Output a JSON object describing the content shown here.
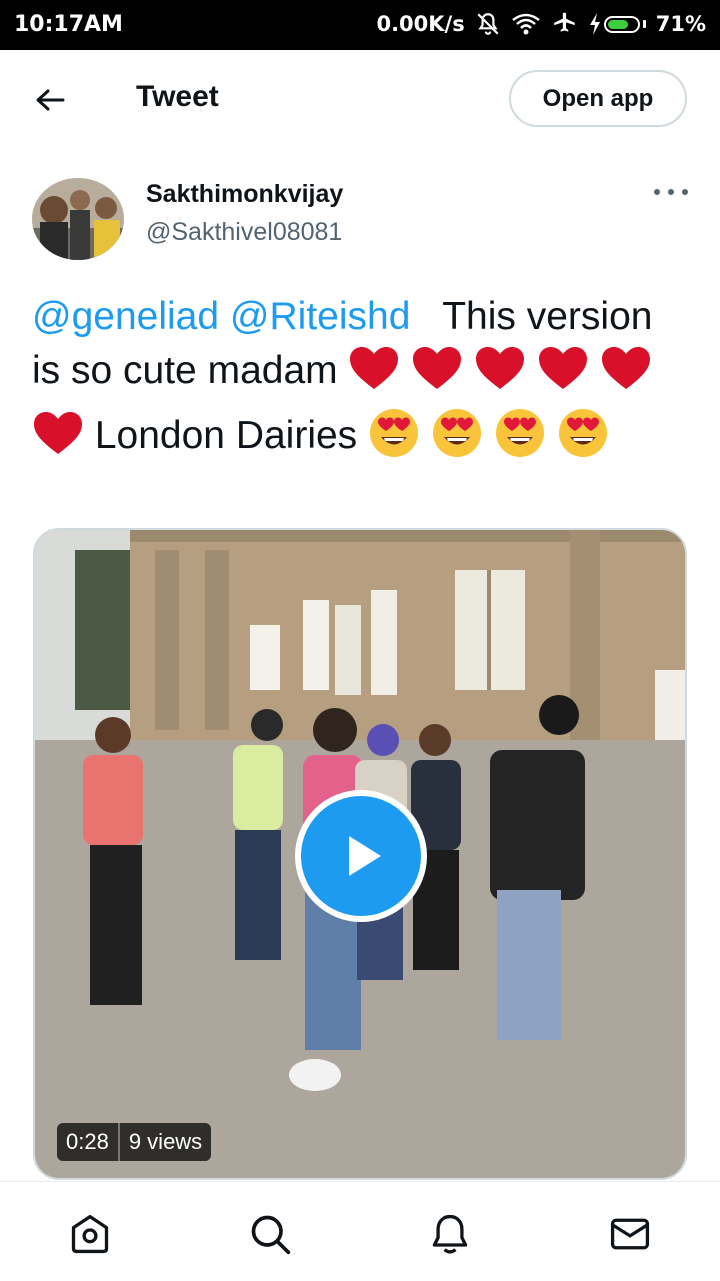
{
  "status_bar": {
    "time": "10:17AM",
    "net_speed": "0.00K/s",
    "battery_pct": "71%",
    "battery_level": 0.71,
    "icons": [
      "mute-icon",
      "wifi-icon",
      "airplane-icon",
      "charging-icon",
      "battery-icon"
    ]
  },
  "header": {
    "title": "Tweet",
    "open_app_label": "Open app",
    "back_icon": "arrow-left-icon"
  },
  "tweet": {
    "display_name": "Sakthimonkvijay",
    "handle": "@Sakthivel08081",
    "mention1": "@geneliad",
    "mention2": "@Riteishd",
    "text_part1": "This version is so cute madam",
    "text_part2": "London Dairies",
    "emoji_heart": "heart-emoji",
    "emoji_face": "heart-eyes-emoji"
  },
  "video": {
    "duration": "0:28",
    "views": "9 views"
  },
  "bottom_nav": {
    "items": [
      "home-icon",
      "search-icon",
      "notifications-icon",
      "messages-icon"
    ]
  },
  "colors": {
    "accent": "#1d9bf0",
    "heart": "#d9102a",
    "text": "#0f1419",
    "secondary_text": "#536471"
  }
}
